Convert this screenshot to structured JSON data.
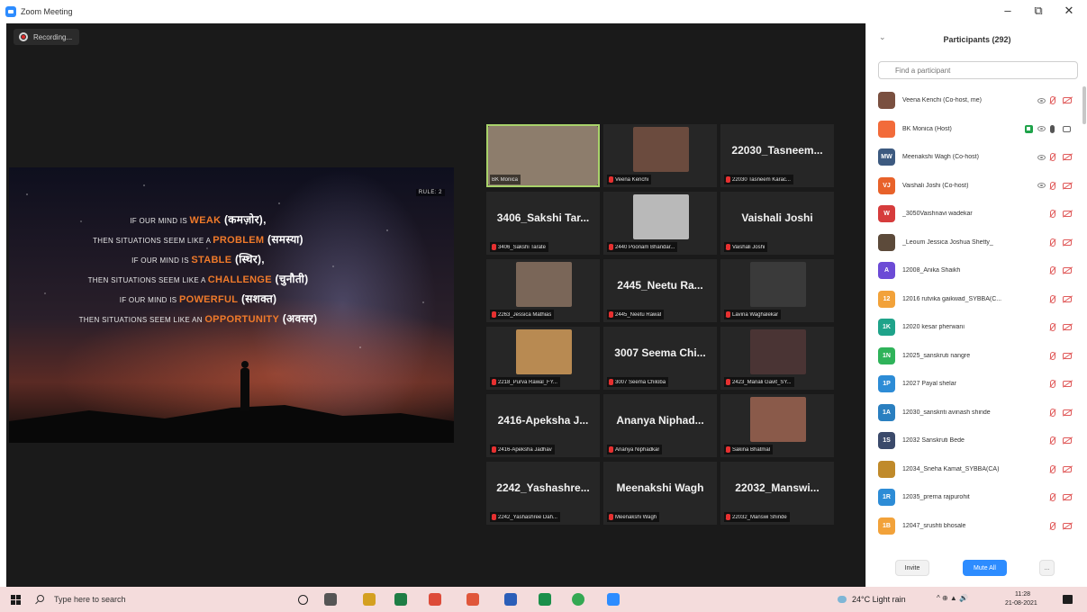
{
  "window": {
    "title": "Zoom Meeting",
    "controls": [
      "–",
      "⧉",
      "✕"
    ]
  },
  "recording": {
    "label": "Recording..."
  },
  "share": {
    "rule_tag": "RULE: 2",
    "lines": [
      {
        "pre": "IF OUR MIND IS ",
        "hl": "WEAK",
        "hi": " (कमज़ोर),"
      },
      {
        "pre": "THEN SITUATIONS SEEM LIKE A ",
        "hl": "PROBLEM",
        "hi": " (समस्या)"
      },
      {
        "pre": "IF OUR MIND IS ",
        "hl": "STABLE",
        "hi": " (स्थिर),"
      },
      {
        "pre": "THEN SITUATIONS SEEM LIKE A ",
        "hl": "CHALLENGE",
        "hi": " (चुनौती)"
      },
      {
        "pre": "IF OUR MIND IS ",
        "hl": "POWERFUL",
        "hi": " (सशक्त)"
      },
      {
        "pre": "THEN SITUATIONS SEEM LIKE AN ",
        "hl": "OPPORTUNITY",
        "hi": " (अवसर)"
      }
    ]
  },
  "gallery": [
    {
      "big": "",
      "caption": "BK Monica",
      "photo": "#8d7d6c",
      "muted": false,
      "active": true
    },
    {
      "big": "",
      "caption": "Veena Kenchi",
      "photo": "#6b4b3e"
    },
    {
      "big": "22030_Tasneem...",
      "caption": "22030 Tasneem Karac..."
    },
    {
      "big": "3406_Sakshi Tar...",
      "caption": "3406_Sakshi Tarate"
    },
    {
      "big": "",
      "caption": "2440 Poonam Bhandar...",
      "photo": "#b9b9b9"
    },
    {
      "big": "Vaishali Joshi",
      "caption": "Vaishali Joshi"
    },
    {
      "big": "",
      "caption": "2263_Jessica Mathias",
      "photo": "#7a6658"
    },
    {
      "big": "2445_Neetu Ra...",
      "caption": "2445_Neetu Rawat"
    },
    {
      "big": "",
      "caption": "Lavina Waghalekar",
      "photo": "#3a3a3a"
    },
    {
      "big": "",
      "caption": "2218_Purva Rawal_FY...",
      "photo": "#b88a52"
    },
    {
      "big": "3007 Seema Chi...",
      "caption": "3007 Seema Chiloba"
    },
    {
      "big": "",
      "caption": "2423_Manali Gavit_SY...",
      "photo": "#4a3434"
    },
    {
      "big": "2416-Apeksha J...",
      "caption": "2416-Apeksha Jadhav"
    },
    {
      "big": "Ananya Niphad...",
      "caption": "Ananya Niphadkar"
    },
    {
      "big": "",
      "caption": "Sakina Bhatmal",
      "photo": "#8a5a4a"
    },
    {
      "big": "2242_Yashashre...",
      "caption": "2242_Yashashree Dah..."
    },
    {
      "big": "Meenakshi Wagh",
      "caption": "Meenakshi Wagh"
    },
    {
      "big": "22032_Manswi...",
      "caption": "22032_Manswi Shinde"
    }
  ],
  "participants_panel": {
    "title": "Participants (292)",
    "search_placeholder": "Find a participant",
    "rows": [
      {
        "name": "Veena Kenchi (Co-host, me)",
        "avatar": "",
        "color": "#7a5040",
        "icons": [
          "eye",
          "mic-muted",
          "cam-off"
        ]
      },
      {
        "name": "BK Monica (Host)",
        "avatar": "",
        "color": "#f26b3a",
        "icons": [
          "share",
          "eye",
          "mic-on",
          "cam-on"
        ]
      },
      {
        "name": "Meenakshi Wagh (Co-host)",
        "avatar": "MW",
        "color": "#3d5a80",
        "icons": [
          "eye",
          "mic-muted",
          "cam-off"
        ]
      },
      {
        "name": "Vaishali Joshi (Co-host)",
        "avatar": "VJ",
        "color": "#e8622a",
        "icons": [
          "eye",
          "mic-muted",
          "cam-off"
        ]
      },
      {
        "name": "_3050Vaishnavi wadekar",
        "avatar": "W",
        "color": "#d63c3c",
        "icons": [
          "mic-muted",
          "cam-off"
        ]
      },
      {
        "name": "_Leoum Jessica Joshua Shetty_",
        "avatar": "",
        "color": "#5c4a3a",
        "icons": [
          "mic-muted",
          "cam-off"
        ]
      },
      {
        "name": "12008_Anika Shaikh",
        "avatar": "A",
        "color": "#6c4bd6",
        "icons": [
          "mic-muted",
          "cam-off"
        ]
      },
      {
        "name": "12016 rutvika gaikwad_SYBBA(C...",
        "avatar": "12",
        "color": "#f2a23a",
        "icons": [
          "mic-muted",
          "cam-off"
        ]
      },
      {
        "name": "12020 kesar pherwani",
        "avatar": "1K",
        "color": "#1fa38a",
        "icons": [
          "mic-muted",
          "cam-off"
        ]
      },
      {
        "name": "12025_sanskruti nangre",
        "avatar": "1N",
        "color": "#2fb35a",
        "icons": [
          "mic-muted",
          "cam-off"
        ]
      },
      {
        "name": "12027 Payal shelar",
        "avatar": "1P",
        "color": "#2d8cd6",
        "icons": [
          "mic-muted",
          "cam-off"
        ]
      },
      {
        "name": "12030_sanskriti avinash shinde",
        "avatar": "1A",
        "color": "#2a7fc0",
        "icons": [
          "mic-muted",
          "cam-off"
        ]
      },
      {
        "name": "12032 Sanskruti Bede",
        "avatar": "1S",
        "color": "#3b4a6b",
        "icons": [
          "mic-muted",
          "cam-off"
        ]
      },
      {
        "name": "12034_Sneha Kamat_SYBBA(CA)",
        "avatar": "",
        "color": "#c08a2a",
        "icons": [
          "mic-muted",
          "cam-off"
        ]
      },
      {
        "name": "12035_prerna rajpurohit",
        "avatar": "1R",
        "color": "#2d8cd6",
        "icons": [
          "mic-muted",
          "cam-off"
        ]
      },
      {
        "name": "12047_srushti bhosale",
        "avatar": "1B",
        "color": "#f2a23a",
        "icons": [
          "mic-muted",
          "cam-off"
        ]
      }
    ],
    "footer": {
      "invite": "Invite",
      "mute_all": "Mute All",
      "more": "..."
    }
  },
  "taskbar": {
    "search_placeholder": "Type here to search",
    "apps": [
      "cortana",
      "task-view",
      "file-explorer",
      "excel",
      "chrome",
      "photos",
      "word",
      "whatsapp",
      "chrome-2",
      "zoom"
    ],
    "weather": "24°C  Light rain",
    "tray": "^  ⊕  ▲  🔊",
    "time": "11:28",
    "date": "21-08-2021"
  }
}
